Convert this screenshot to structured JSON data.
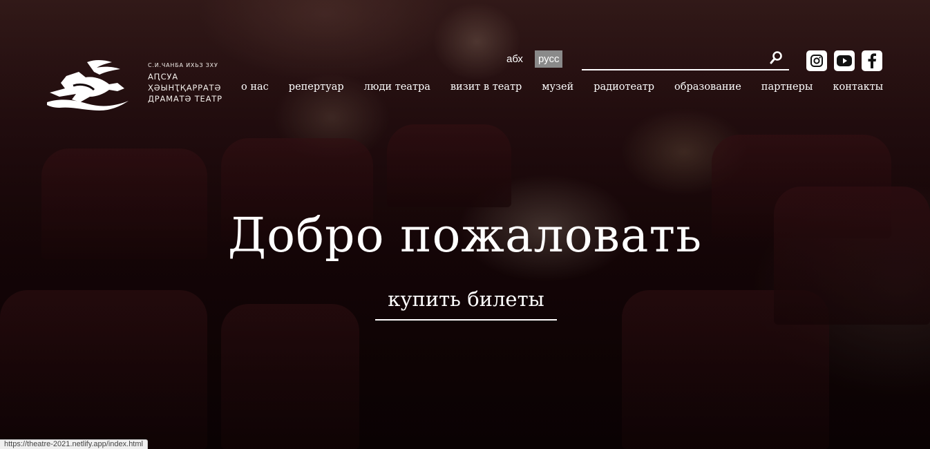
{
  "logo": {
    "line_small": "С.И.ЧАНБА ИХЬЗ ЗХУ",
    "line1": "АԤСУА",
    "line2": "ҲӘЫНҬҚАРРАТӘ",
    "line3": "ДРАМАТӘ ТЕАТР",
    "icon": "deer-icon"
  },
  "languages": [
    {
      "label": "абх",
      "active": false
    },
    {
      "label": "русс",
      "active": true
    }
  ],
  "search": {
    "placeholder": "",
    "value": ""
  },
  "social": [
    "instagram-icon",
    "youtube-icon",
    "facebook-icon"
  ],
  "nav": [
    "о нас",
    "репертуар",
    "люди театра",
    "визит в театр",
    "музей",
    "радиотеатр",
    "образование",
    "партнеры",
    "контакты"
  ],
  "hero": {
    "title": "Добро пожаловать",
    "cta": "купить билеты"
  },
  "status_bar": "https://theatre-2021.netlify.app/index.html"
}
